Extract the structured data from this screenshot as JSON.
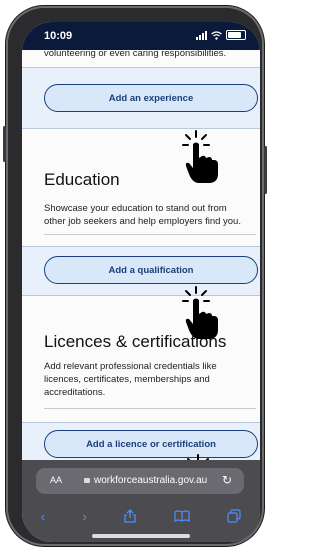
{
  "status_bar": {
    "time": "10:09"
  },
  "page": {
    "cut_text": "volunteering or even caring responsibilities.",
    "experience_button": "Add an experience",
    "education": {
      "heading": "Education",
      "description": "Showcase your education to stand out from other job seekers and help employers find you.",
      "button": "Add a qualification"
    },
    "licences": {
      "heading": "Licences & certifications",
      "description": "Add relevant professional credentials like licences, certificates, memberships and accreditations.",
      "button": "Add a licence or certification"
    }
  },
  "browser": {
    "text_size_label": "AA",
    "url": "workforceaustralia.gov.au",
    "icons": [
      "back-icon",
      "forward-icon",
      "share-icon",
      "bookmarks-icon",
      "tabs-icon",
      "reload-icon",
      "lock-icon"
    ]
  },
  "colors": {
    "accent": "#1b3f7c",
    "band": "#e7f0fb",
    "safari_blue": "#4a90ff"
  }
}
